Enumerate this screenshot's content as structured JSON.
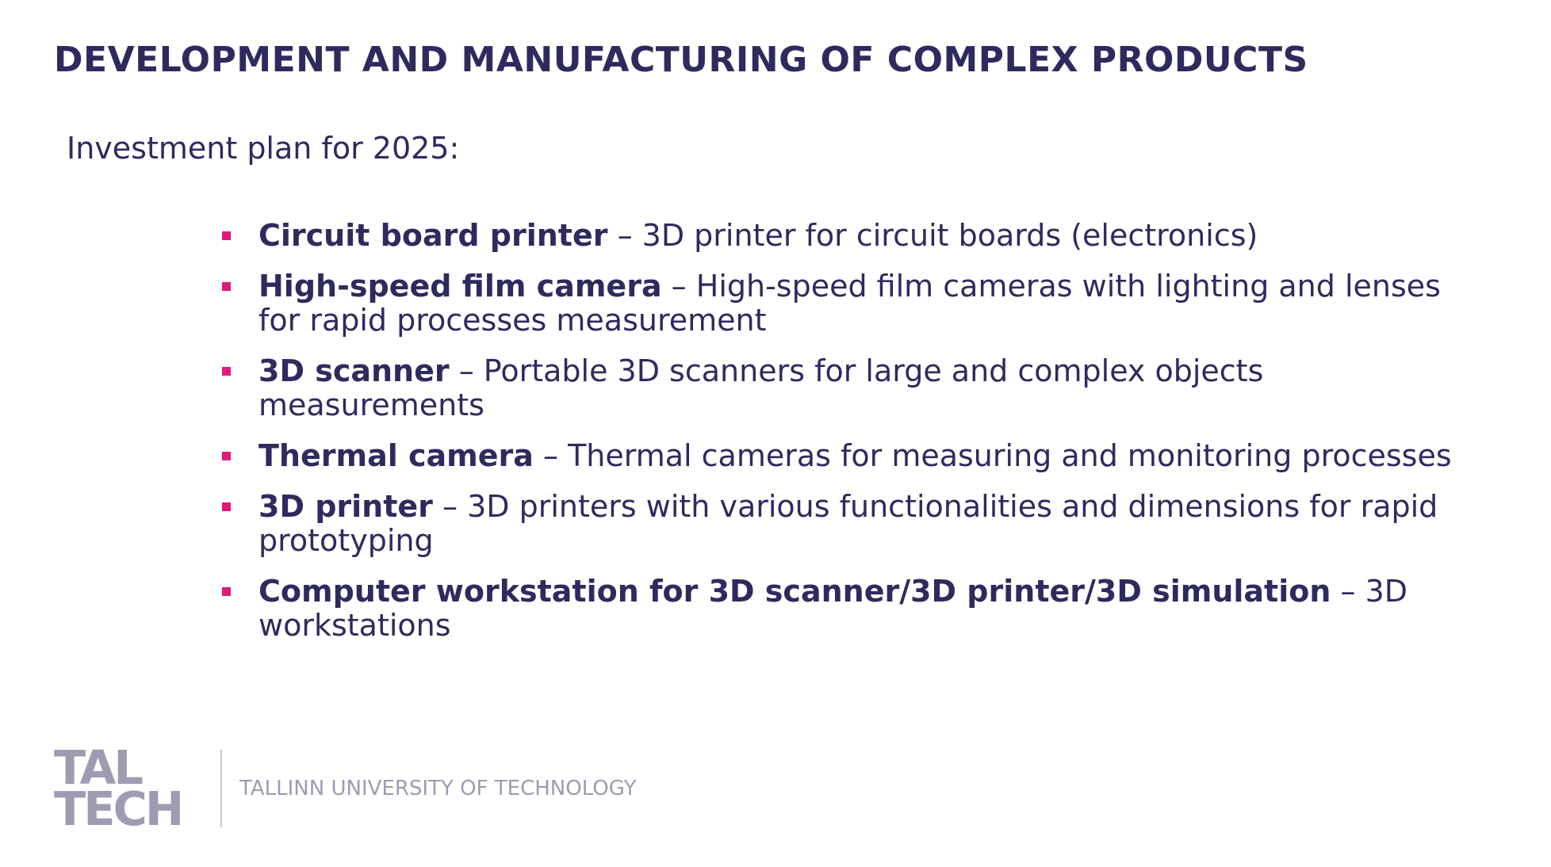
{
  "slide": {
    "title": "DEVELOPMENT AND MANUFACTURING OF COMPLEX PRODUCTS",
    "subtitle": "Investment plan for 2025:",
    "items": [
      {
        "term": "Circuit board printer",
        "description": " – 3D printer for circuit boards (electronics)"
      },
      {
        "term": "High-speed film camera",
        "description": " – High-speed film cameras with lighting and lenses for rapid processes measurement"
      },
      {
        "term": "3D scanner",
        "description": " – Portable 3D scanners for large and complex objects measurements"
      },
      {
        "term": "Thermal camera",
        "description": " – Thermal cameras for measuring and monitoring processes"
      },
      {
        "term": "3D printer",
        "description": " – 3D printers with various functionalities and dimensions for rapid prototyping"
      },
      {
        "term": "Computer workstation for 3D scanner/3D printer/3D simulation",
        "description": " – 3D workstations"
      }
    ]
  },
  "footer": {
    "logo_line1": "TAL",
    "logo_line2": "TECH",
    "university": "TALLINN UNIVERSITY OF TECHNOLOGY"
  },
  "colors": {
    "text": "#2f2a5e",
    "bullet": "#e0197d",
    "footer": "#9d9cb2"
  }
}
